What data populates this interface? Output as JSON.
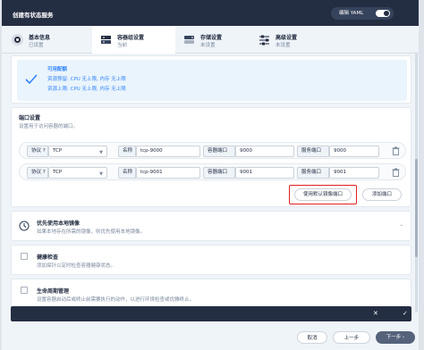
{
  "header": {
    "title": "创建有状态服务",
    "yaml_label": "编辑 YAML"
  },
  "steps": [
    {
      "name": "基本信息",
      "status": "已设置",
      "icon": "basic-info-icon"
    },
    {
      "name": "容器组设置",
      "status": "当前",
      "icon": "container-icon"
    },
    {
      "name": "存储设置",
      "status": "未设置",
      "icon": "storage-icon"
    },
    {
      "name": "高级设置",
      "status": "未设置",
      "icon": "advanced-icon"
    }
  ],
  "quota": {
    "title": "可用配额",
    "line1": "资源预留: CPU 无上限, 内存 无上限",
    "line2": "资源上限: CPU 无上限, 内存 无上限"
  },
  "ports": {
    "title": "端口设置",
    "desc": "设置用于访问容器的端口。",
    "protocol_label": "协议",
    "name_label": "名称",
    "container_port_label": "容器端口",
    "service_port_label": "服务端口",
    "rows": [
      {
        "protocol": "TCP",
        "name": "tcp-9000",
        "container_port": "9000",
        "service_port": "9000"
      },
      {
        "protocol": "TCP",
        "name": "tcp-9001",
        "container_port": "9001",
        "service_port": "9001"
      }
    ],
    "use_default_label": "使用默认镜像端口",
    "add_port_label": "添加端口"
  },
  "local_image": {
    "title": "优先使用本地镜像",
    "desc": "如果本地存在所需的镜像，则优先使用本地镜像。"
  },
  "health": {
    "title": "健康检查",
    "desc": "添加探针以定时检查容器健康状态。"
  },
  "lifecycle": {
    "title": "生命周期管理",
    "desc": "设置容器启动后或终止前需要执行的动作，以进行环境检查或优雅终止。"
  },
  "footer": {
    "cancel": "取消",
    "prev": "上一步",
    "next": "下一步"
  },
  "colors": {
    "header": "#242e42",
    "accent": "#3385ff",
    "highlight": "#e02020"
  }
}
